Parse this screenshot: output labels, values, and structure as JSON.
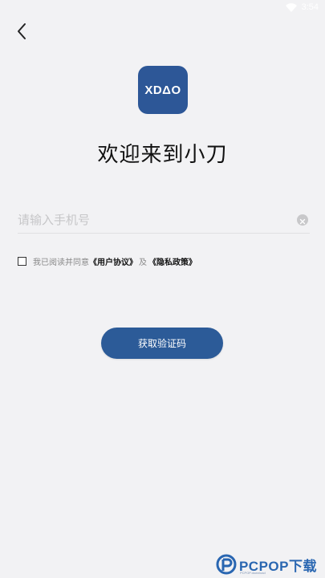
{
  "status_bar": {
    "time": "3:54",
    "wifi_icon": "wifi-icon",
    "text_color": "#ffffff"
  },
  "nav": {
    "back_icon": "chevron-left-icon"
  },
  "logo": {
    "text": "XDΔO",
    "bg_color": "#2d5797"
  },
  "title": "欢迎来到小刀",
  "phone": {
    "placeholder": "请输入手机号",
    "value": "",
    "clear_icon": "clear-circle-icon"
  },
  "agreement": {
    "checked": false,
    "prefix": "我已阅读并同意",
    "user_agreement": "《用户协议》",
    "connector": "及",
    "privacy_policy": "《隐私政策》"
  },
  "actions": {
    "get_code_label": "获取验证码",
    "accent_color": "#2c5b98"
  },
  "watermark": {
    "brand": "PCPOP下载",
    "sub": "PCPOP.download"
  }
}
